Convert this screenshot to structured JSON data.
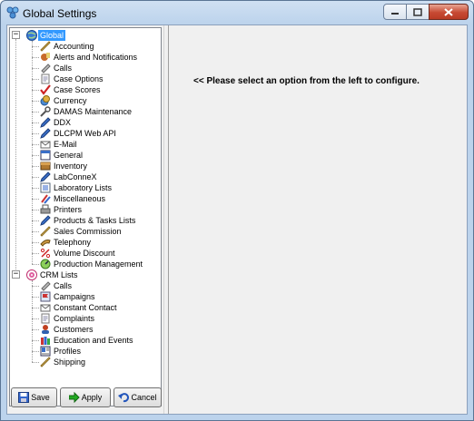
{
  "window": {
    "title": "Global Settings"
  },
  "tree": {
    "global": {
      "label": "Global",
      "items": [
        {
          "label": "Accounting",
          "icon": "ruler-icon"
        },
        {
          "label": "Alerts and Notifications",
          "icon": "alert-icon"
        },
        {
          "label": "Calls",
          "icon": "phone-icon"
        },
        {
          "label": "Case Options",
          "icon": "document-icon"
        },
        {
          "label": "Case Scores",
          "icon": "check-icon"
        },
        {
          "label": "Currency",
          "icon": "coins-icon"
        },
        {
          "label": "DAMAS Maintenance",
          "icon": "tools-icon"
        },
        {
          "label": "DDX",
          "icon": "pen-icon"
        },
        {
          "label": "DLCPM Web API",
          "icon": "pen-icon"
        },
        {
          "label": "E-Mail",
          "icon": "mail-icon"
        },
        {
          "label": "General",
          "icon": "window-icon"
        },
        {
          "label": "Inventory",
          "icon": "box-icon"
        },
        {
          "label": "LabConneX",
          "icon": "pen-icon"
        },
        {
          "label": "Laboratory Lists",
          "icon": "list-icon"
        },
        {
          "label": "Miscellaneous",
          "icon": "pencils-icon"
        },
        {
          "label": "Printers",
          "icon": "printer-icon"
        },
        {
          "label": "Products & Tasks Lists",
          "icon": "pen-icon"
        },
        {
          "label": "Sales Commission",
          "icon": "ruler-icon"
        },
        {
          "label": "Telephony",
          "icon": "handset-icon"
        },
        {
          "label": "Volume Discount",
          "icon": "percent-icon"
        },
        {
          "label": "Production Management",
          "icon": "gauge-icon"
        }
      ]
    },
    "crm": {
      "label": "CRM Lists",
      "items": [
        {
          "label": "Calls",
          "icon": "phone-icon"
        },
        {
          "label": "Campaigns",
          "icon": "flag-icon"
        },
        {
          "label": "Constant Contact",
          "icon": "mail-icon"
        },
        {
          "label": "Complaints",
          "icon": "document-icon"
        },
        {
          "label": "Customers",
          "icon": "person-icon"
        },
        {
          "label": "Education and Events",
          "icon": "books-icon"
        },
        {
          "label": "Profiles",
          "icon": "card-icon"
        },
        {
          "label": "Shipping",
          "icon": "ruler-icon"
        }
      ]
    }
  },
  "buttons": {
    "save": {
      "label": "Save",
      "underline": "S"
    },
    "apply": {
      "label": "Apply",
      "underline": "A"
    },
    "cancel": {
      "label": "Cancel",
      "underline": "C"
    }
  },
  "message": "<< Please select an option from the left to configure.",
  "colors": {
    "selection": "#3399ff",
    "background": "#f0f0f0"
  }
}
